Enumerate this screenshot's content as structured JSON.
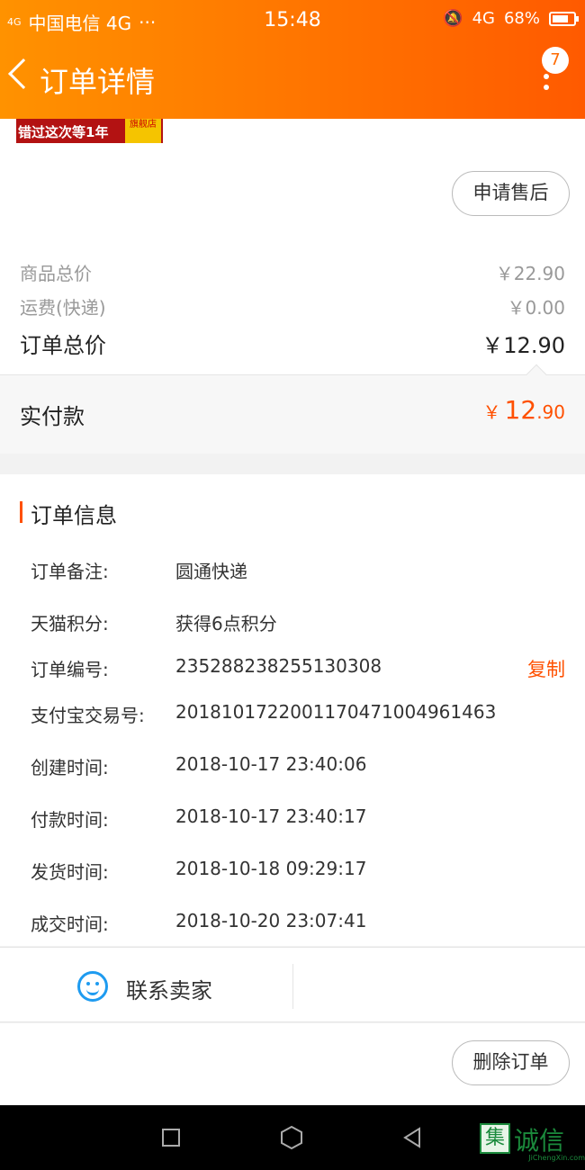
{
  "status_bar": {
    "signal": "4G",
    "carrier": "中国电信 4G",
    "more": "···",
    "time": "15:48",
    "network": "4G",
    "battery": "68%"
  },
  "nav": {
    "title": "订单详情",
    "badge_count": "7"
  },
  "product": {
    "thumbnail_text": "错过这次等1年",
    "thumbnail_store": "旗舰店",
    "after_sale_button": "申请售后"
  },
  "price": {
    "goods_total_label": "商品总价",
    "goods_total_value": "￥22.90",
    "shipping_label": "运费(快递)",
    "shipping_value": "￥0.00",
    "order_total_label": "订单总价",
    "order_total_value": "￥12.90",
    "paid_label": "实付款",
    "paid_currency": "￥",
    "paid_integer": "12",
    "paid_decimal": ".90"
  },
  "order_info": {
    "title": "订单信息",
    "copy_label": "复制",
    "rows": [
      {
        "label": "订单备注:",
        "value": "圆通快递"
      },
      {
        "label": "天猫积分:",
        "value": "获得6点积分"
      },
      {
        "label": "订单编号:",
        "value": "235288238255130308"
      },
      {
        "label": "支付宝交易号:",
        "value": "2018101722001170471004961463"
      },
      {
        "label": "创建时间:",
        "value": "2018-10-17 23:40:06"
      },
      {
        "label": "付款时间:",
        "value": "2018-10-17 23:40:17"
      },
      {
        "label": "发货时间:",
        "value": "2018-10-18 09:29:17"
      },
      {
        "label": "成交时间:",
        "value": "2018-10-20 23:07:41"
      }
    ]
  },
  "contact": {
    "label": "联系卖家"
  },
  "footer": {
    "delete_button": "删除订单"
  },
  "watermark": {
    "logo": "集",
    "text": "诚信",
    "sub": "JiChengXin.com"
  },
  "colors": {
    "header_start": "#ff9200",
    "header_end": "#ff5a00",
    "accent": "#ff5000",
    "contact_icon": "#1e9bf0"
  }
}
